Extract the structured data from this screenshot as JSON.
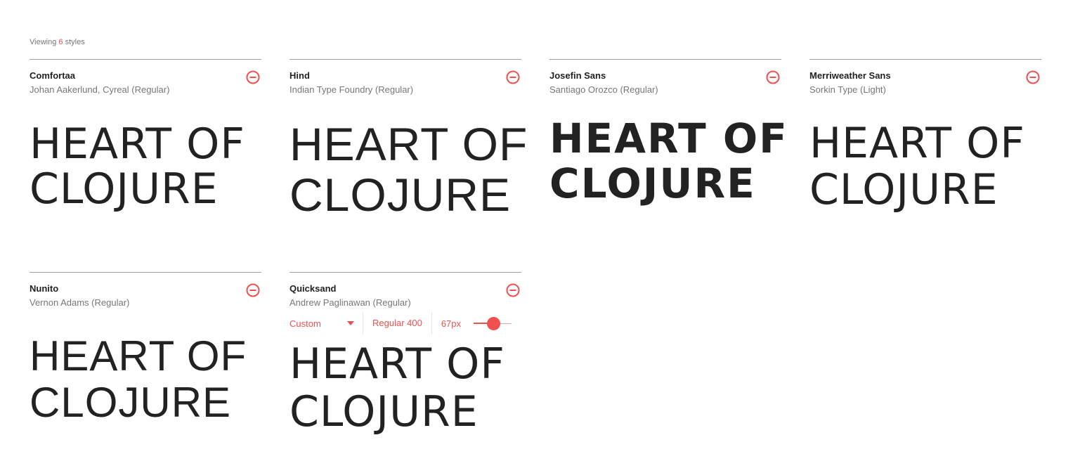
{
  "header": {
    "viewing_prefix": "Viewing",
    "viewing_count": "6",
    "viewing_suffix": "styles"
  },
  "sample_text": {
    "line1": "HEART OF",
    "line2": "CLOJURE"
  },
  "cards": [
    {
      "name": "Comfortaa",
      "designer": "Johan Aakerlund, Cyreal (Regular)"
    },
    {
      "name": "Hind",
      "designer": "Indian Type Foundry (Regular)"
    },
    {
      "name": "Josefin Sans",
      "designer": "Santiago Orozco (Regular)"
    },
    {
      "name": "Merriweather Sans",
      "designer": "Sorkin Type (Light)"
    },
    {
      "name": "Nunito",
      "designer": "Vernon Adams (Regular)"
    },
    {
      "name": "Quicksand",
      "designer": "Andrew Paglinawan (Regular)"
    }
  ],
  "controls": {
    "style_select": "Custom",
    "weight": "Regular 400",
    "size": "67px",
    "size_value": 67
  },
  "colors": {
    "accent": "#f05050",
    "text": "#222222",
    "muted": "#777777",
    "divider": "#9e9e9e"
  },
  "icons": {
    "remove": "minus-circle-icon",
    "dropdown": "caret-down-icon"
  }
}
